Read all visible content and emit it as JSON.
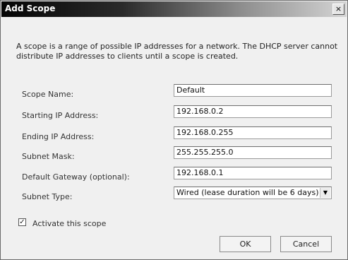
{
  "window": {
    "title": "Add Scope",
    "close_glyph": "×"
  },
  "description": "A scope is a range of possible IP addresses for a network. The DHCP server cannot distribute IP addresses to clients until a scope is created.",
  "form": {
    "scope_name": {
      "label": "Scope Name:",
      "value": "Default"
    },
    "starting_ip": {
      "label": "Starting IP Address:",
      "value": "192.168.0.2"
    },
    "ending_ip": {
      "label": "Ending IP Address:",
      "value": "192.168.0.255"
    },
    "subnet_mask": {
      "label": "Subnet Mask:",
      "value": "255.255.255.0"
    },
    "default_gateway": {
      "label": "Default Gateway (optional):",
      "value": "192.168.0.1"
    },
    "subnet_type": {
      "label": "Subnet Type:",
      "value": "Wired (lease duration will be 6 days)"
    }
  },
  "activate": {
    "label": "Activate this scope",
    "checked": true,
    "check_glyph": "✓"
  },
  "buttons": {
    "ok": "OK",
    "cancel": "Cancel"
  },
  "icons": {
    "close": "close-icon",
    "dropdown": "chevron-down-icon"
  }
}
